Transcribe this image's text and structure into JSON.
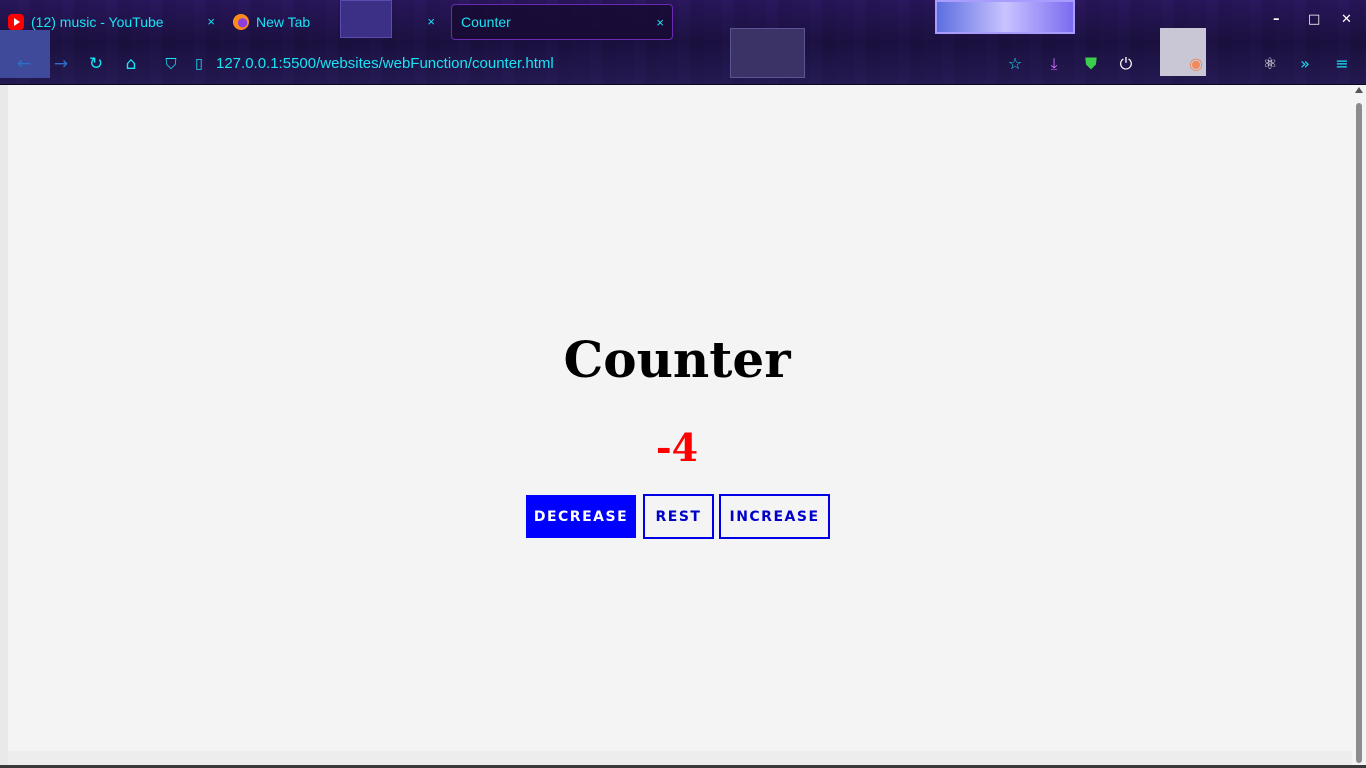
{
  "browser": {
    "tabs": [
      {
        "label": "(12) music - YouTube",
        "icon": "youtube-icon",
        "close": "×"
      },
      {
        "label": "New Tab",
        "icon": "firefox-icon",
        "close": "×"
      },
      {
        "label": "Counter",
        "icon": "none",
        "close": "×",
        "active": true
      }
    ],
    "url": "127.0.0.1:5500/websites/webFunction/counter.html",
    "window_controls": {
      "minimize": "–",
      "maximize": "□",
      "close": "✕"
    },
    "nav_icons": [
      "back-arrow-icon",
      "forward-arrow-icon",
      "reload-icon",
      "home-icon",
      "shield-icon",
      "page-icon"
    ],
    "toolbar_icons": [
      "bookmark-star-icon",
      "downloads-icon",
      "ublock-shield-icon",
      "power-icon",
      "extension-icon",
      "react-devtools-icon",
      "overflow-chevron-icon",
      "menu-icon"
    ],
    "accent_color": "#19e3f5"
  },
  "page": {
    "title": "Counter",
    "count": "-4",
    "count_color": "#ff0000",
    "buttons": {
      "decrease": "DECREASE",
      "rest": "REST",
      "increase": "INCREASE"
    },
    "button_color": "#0000ff"
  }
}
